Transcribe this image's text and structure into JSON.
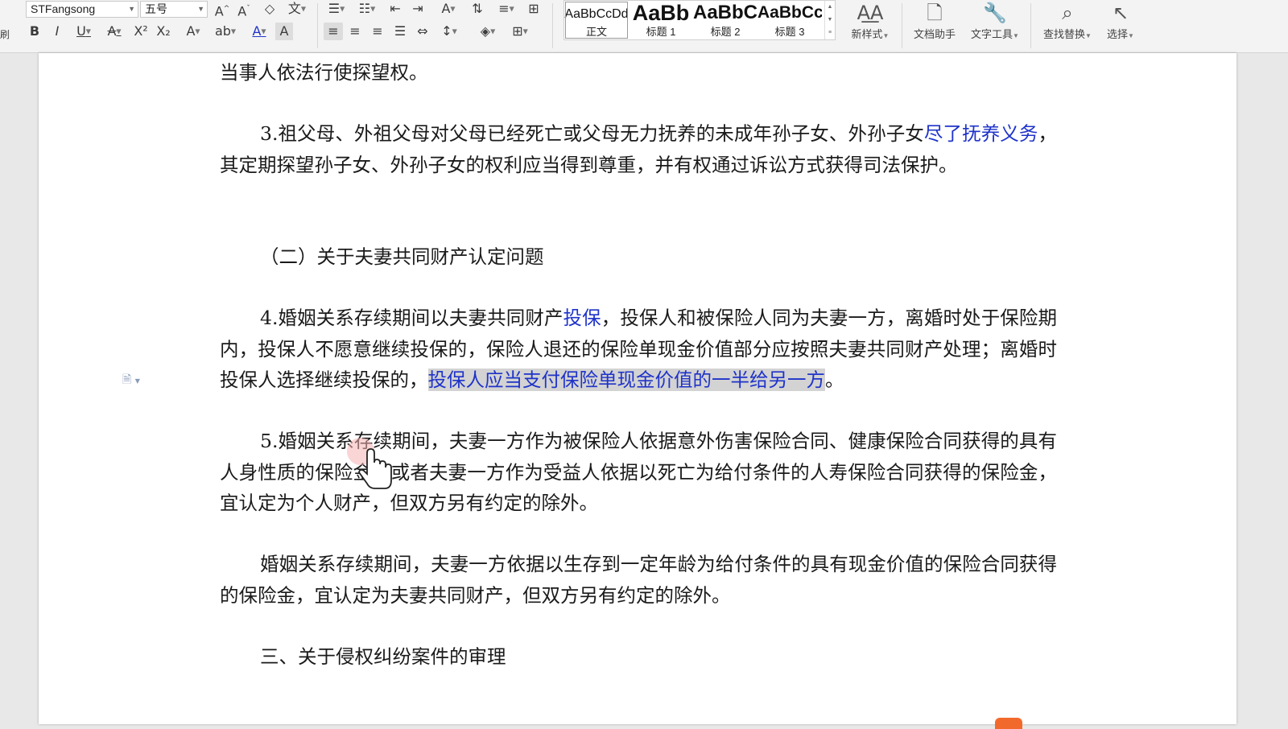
{
  "ribbon": {
    "left_fragment": "刷",
    "font_name": "STFangsong",
    "font_size": "五号",
    "style_gallery": [
      {
        "preview": "AaBbCcDd",
        "name": "正文",
        "selected": true
      },
      {
        "preview": "AaBb",
        "name": "标题 1",
        "selected": false
      },
      {
        "preview": "AaBbC",
        "name": "标题 2",
        "selected": false
      },
      {
        "preview": "AaBbCc",
        "name": "标题 3",
        "selected": false
      }
    ],
    "tools": {
      "new_style": "新样式",
      "doc_assistant": "文档助手",
      "text_tools": "文字工具",
      "find_replace": "查找替换",
      "select": "选择"
    },
    "icons": [
      "grow-font-icon",
      "shrink-font-icon",
      "clear-format-icon",
      "phonetic-icon",
      "bullet-list-icon",
      "numbered-list-icon",
      "decrease-indent-icon",
      "increase-indent-icon",
      "chinese-layout-icon",
      "sort-icon",
      "line-spacing-icon",
      "border-icon",
      "bold-icon",
      "italic-icon",
      "underline-icon",
      "strikethrough-icon",
      "superscript-icon",
      "subscript-icon",
      "text-effect-icon",
      "highlight-icon",
      "font-color-icon",
      "char-shading-icon",
      "align-left-icon",
      "align-center-icon",
      "align-right-icon",
      "justify-icon",
      "distribute-icon",
      "paragraph-spacing-icon",
      "shading-icon",
      "table-border-icon"
    ]
  },
  "document": {
    "p1": "当事人依法行使探望权。",
    "p2_a": "3.祖父母、外祖父母对父母已经死亡或父母无力抚养的未成年孙子女、外孙子女",
    "p2_link": "尽了抚养义务",
    "p2_b": "，其定期探望孙子女、外孙子女的权利应当得到尊重，并有权通过诉讼方式获得司法保护。",
    "p3": "（二）关于夫妻共同财产认定问题",
    "p4_a": "4.婚姻关系存续期间以夫妻共同财产",
    "p4_link": "投保",
    "p4_b": "，投保人和被保险人同为夫妻一方，离婚时处于保险期内，投保人不愿意继续投保的，保险人退还的保险单现金价值部分应按照夫妻共同财产处理；离婚时投保人选择继续投保的，",
    "p4_highlight": "投保人应当支付保险单现金价值的一半给另一方",
    "p4_end": "。",
    "p5": "5.婚姻关系存续期间，夫妻一方作为被保险人依据意外伤害保险合同、健康保险合同获得的具有人身性质的保险金，或者夫妻一方作为受益人依据以死亡为给付条件的人寿保险合同获得的保险金，宜认定为个人财产，但双方另有约定的除外。",
    "p6": "婚姻关系存续期间，夫妻一方依据以生存到一定年龄为给付条件的具有现金价值的保险合同获得的保险金，宜认定为夫妻共同财产，但双方另有约定的除外。",
    "p7": "三、关于侵权纠纷案件的审理"
  },
  "colors": {
    "link": "#1f33c9",
    "selection_bg": "#d3d3d3",
    "ribbon_bg": "#f3f3f3",
    "canvas_bg": "#e8e8e8"
  }
}
